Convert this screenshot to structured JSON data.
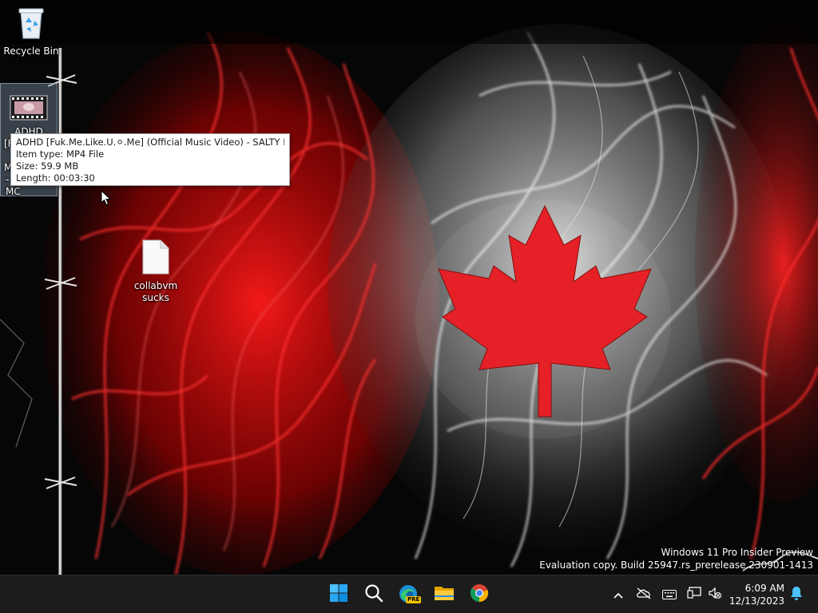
{
  "desktop": {
    "icons": [
      {
        "label": "Recycle Bin",
        "icon": "recycle-bin-icon"
      },
      {
        "label_lines": [
          "ADHD",
          "[F",
          "M",
          "- SALTY MC"
        ],
        "icon": "video-file-icon"
      },
      {
        "label_lines": [
          "collabvm",
          "sucks"
        ],
        "icon": "text-file-icon"
      }
    ]
  },
  "tooltip": {
    "name": "ADHD [Fuk.Me.Like.U.⚪.Me] (Official Music Video) - SALTY MC",
    "item_type": "Item type: MP4 File",
    "size": "Size: 59.9 MB",
    "length": "Length: 00:03:30"
  },
  "watermark": {
    "line1": "Windows 11 Pro Insider Preview",
    "line2": "Evaluation copy. Build 25947.rs_prerelease.230901-1413"
  },
  "taskbar": {
    "apps": [
      {
        "name": "start-button",
        "icon": "windows-logo-icon"
      },
      {
        "name": "search-button",
        "icon": "search-icon"
      },
      {
        "name": "edge-button",
        "icon": "edge-pre-icon",
        "badge": "PRE"
      },
      {
        "name": "file-explorer-button",
        "icon": "folder-icon"
      },
      {
        "name": "chrome-button",
        "icon": "chrome-icon"
      }
    ],
    "tray": [
      "chevron-up-icon",
      "onedrive-offline-icon",
      "keyboard-icon",
      "network-icon",
      "volume-muted-icon"
    ],
    "clock": {
      "time": "6:09 AM",
      "date": "12/13/2023"
    },
    "notification_icon": "bell-icon"
  },
  "colors": {
    "taskbar_bg": "#1c1c1c",
    "flag_red": "#e4141a",
    "accent_blue": "#0078d4"
  }
}
